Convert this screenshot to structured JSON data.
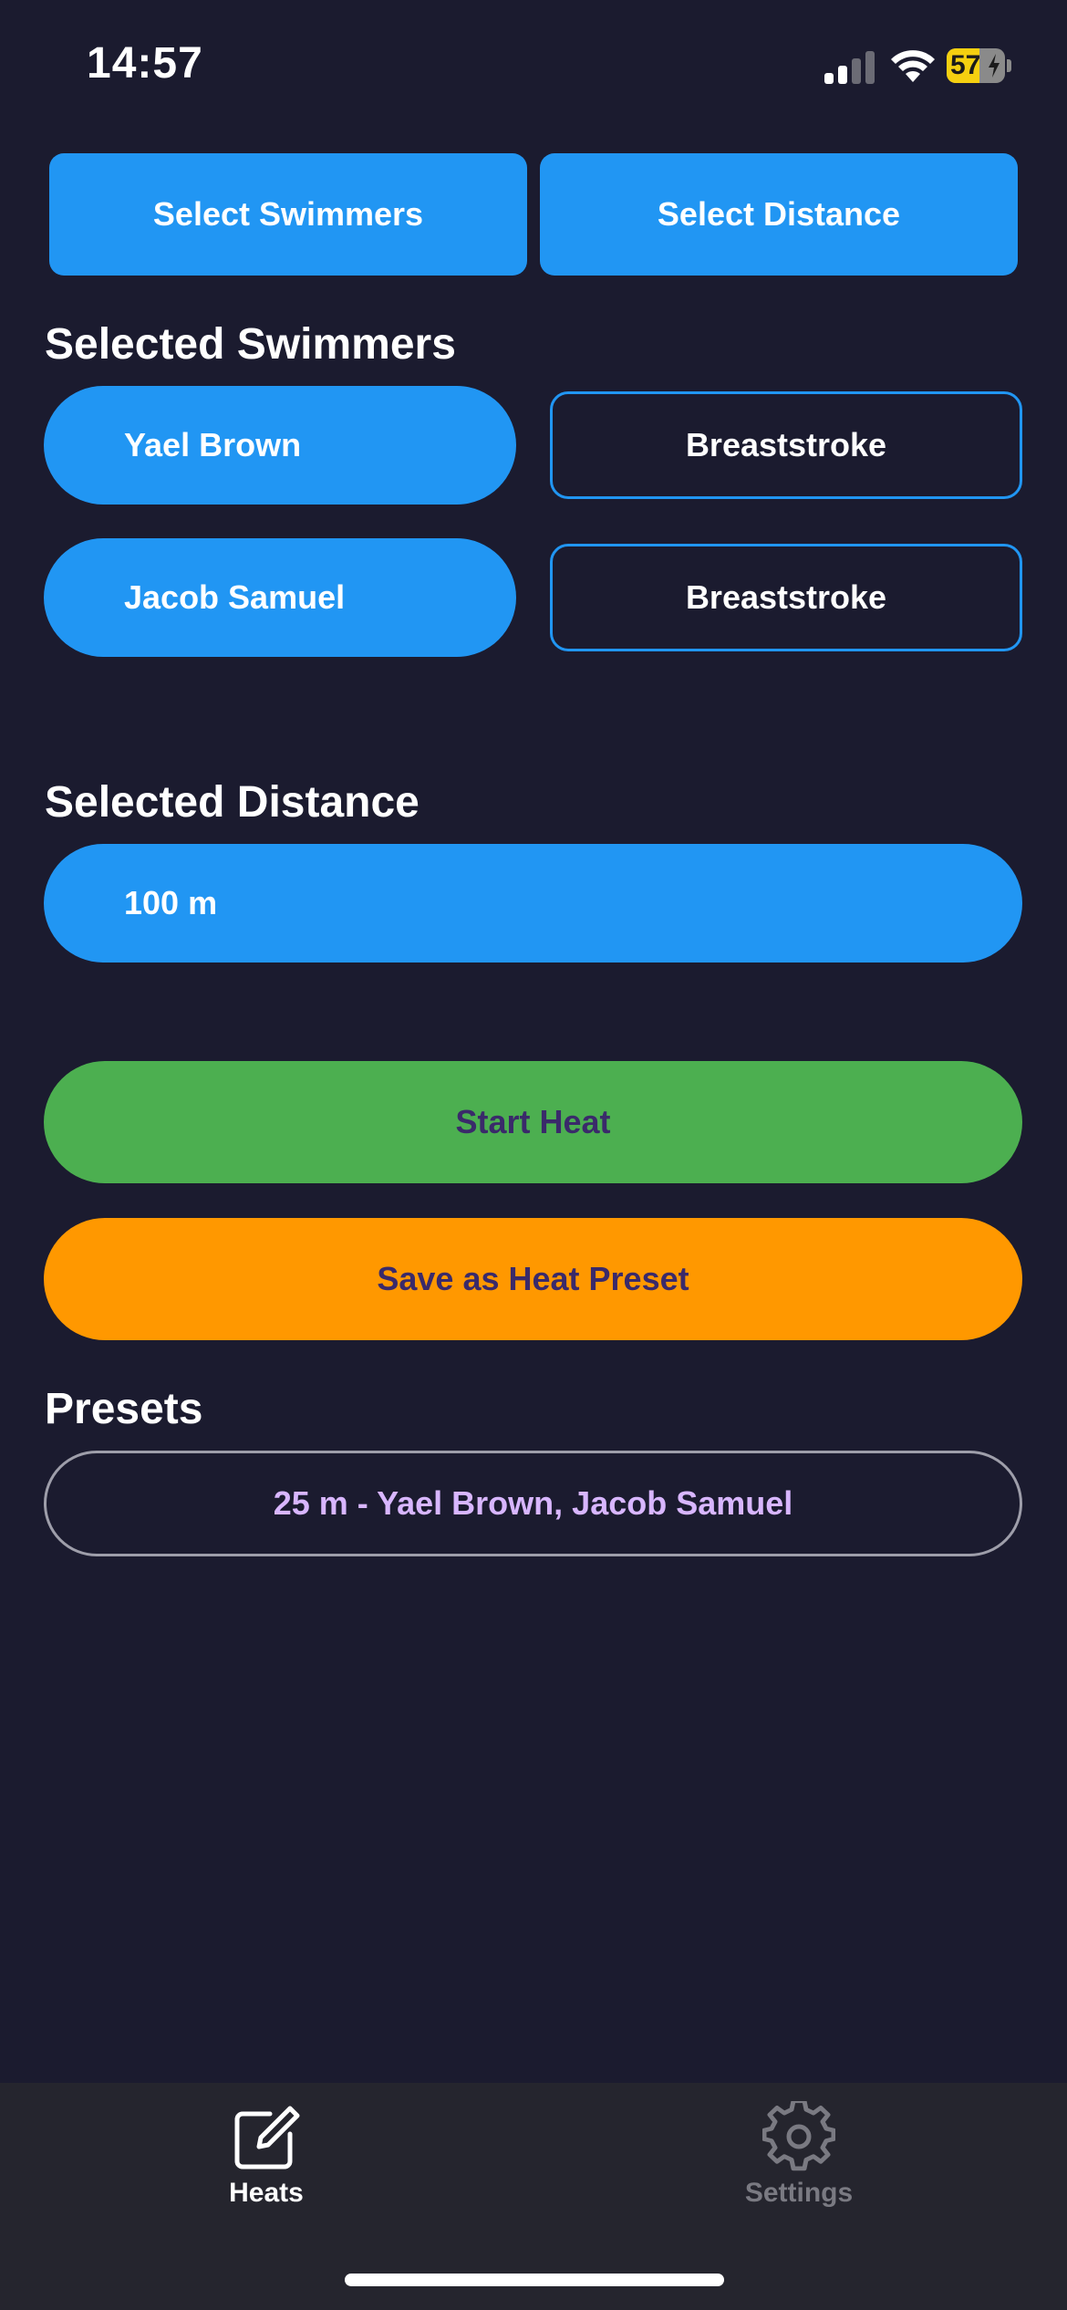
{
  "status_bar": {
    "time": "14:57",
    "battery_level": "57",
    "battery_percent": 57,
    "signal_bars_active": 2,
    "signal_bars_total": 4
  },
  "toolbar": {
    "select_swimmers_label": "Select Swimmers",
    "select_distance_label": "Select Distance"
  },
  "selected_swimmers": {
    "heading": "Selected Swimmers",
    "items": [
      {
        "name": "Yael Brown",
        "stroke": "Breaststroke"
      },
      {
        "name": "Jacob Samuel",
        "stroke": "Breaststroke"
      }
    ]
  },
  "selected_distance": {
    "heading": "Selected Distance",
    "value": "100 m"
  },
  "actions": {
    "start_heat_label": "Start Heat",
    "save_preset_label": "Save as Heat Preset"
  },
  "presets": {
    "heading": "Presets",
    "items": [
      {
        "label": "25 m - Yael Brown, Jacob Samuel"
      }
    ]
  },
  "tab_bar": {
    "tabs": [
      {
        "label": "Heats",
        "icon": "edit-icon",
        "active": true
      },
      {
        "label": "Settings",
        "icon": "gear-icon",
        "active": false
      }
    ]
  },
  "colors": {
    "background": "#1b1b2f",
    "primary_blue": "#2196f3",
    "start_green": "#4caf50",
    "save_orange": "#ff9800",
    "preset_text": "#d8b6ff",
    "battery_yellow": "#f5d010"
  }
}
